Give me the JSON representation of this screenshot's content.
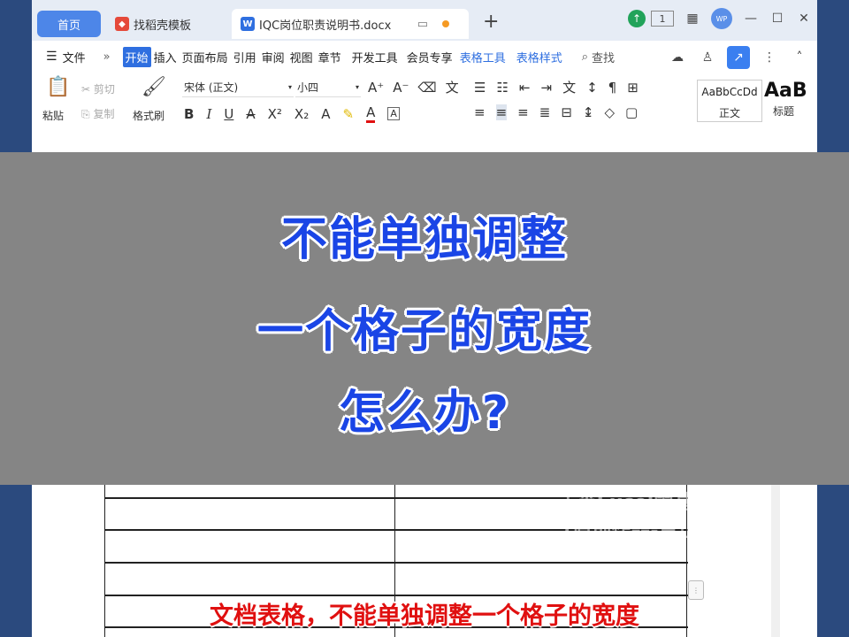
{
  "tabs": {
    "home": "首页",
    "template": "找稻壳模板",
    "document": "IQC岗位职责说明书.docx",
    "add": "+"
  },
  "window": {
    "page_indicator": "1",
    "avatar": "WP"
  },
  "menu": {
    "file": "文件",
    "items": [
      "开始",
      "插入",
      "页面布局",
      "引用",
      "审阅",
      "视图",
      "章节",
      "开发工具",
      "会员专享"
    ],
    "table_tools": "表格工具",
    "table_style": "表格样式",
    "search": "查找"
  },
  "toolbar": {
    "paste": "粘贴",
    "cut": "剪切",
    "copy": "复制",
    "format_painter": "格式刷",
    "font_name": "宋体 (正文)",
    "font_size": "小四",
    "style_normal_preview": "AaBbCcDd",
    "style_normal_label": "正文",
    "style_heading_preview": "AaB",
    "style_heading_label": "标题"
  },
  "banner": {
    "line1": "不能单独调整",
    "line2": "一个格子的宽度",
    "line3": "怎么办?"
  },
  "watermark": {
    "line1": "丁当Excel零基础教学",
    "line2": "(原创作品-禁止搬运)"
  },
  "caption": "文档表格，不能单独调整一个格子的宽度",
  "colors": {
    "banner_text": "#1a45e6",
    "caption_text": "#e01010",
    "accent": "#2f6fe0"
  }
}
